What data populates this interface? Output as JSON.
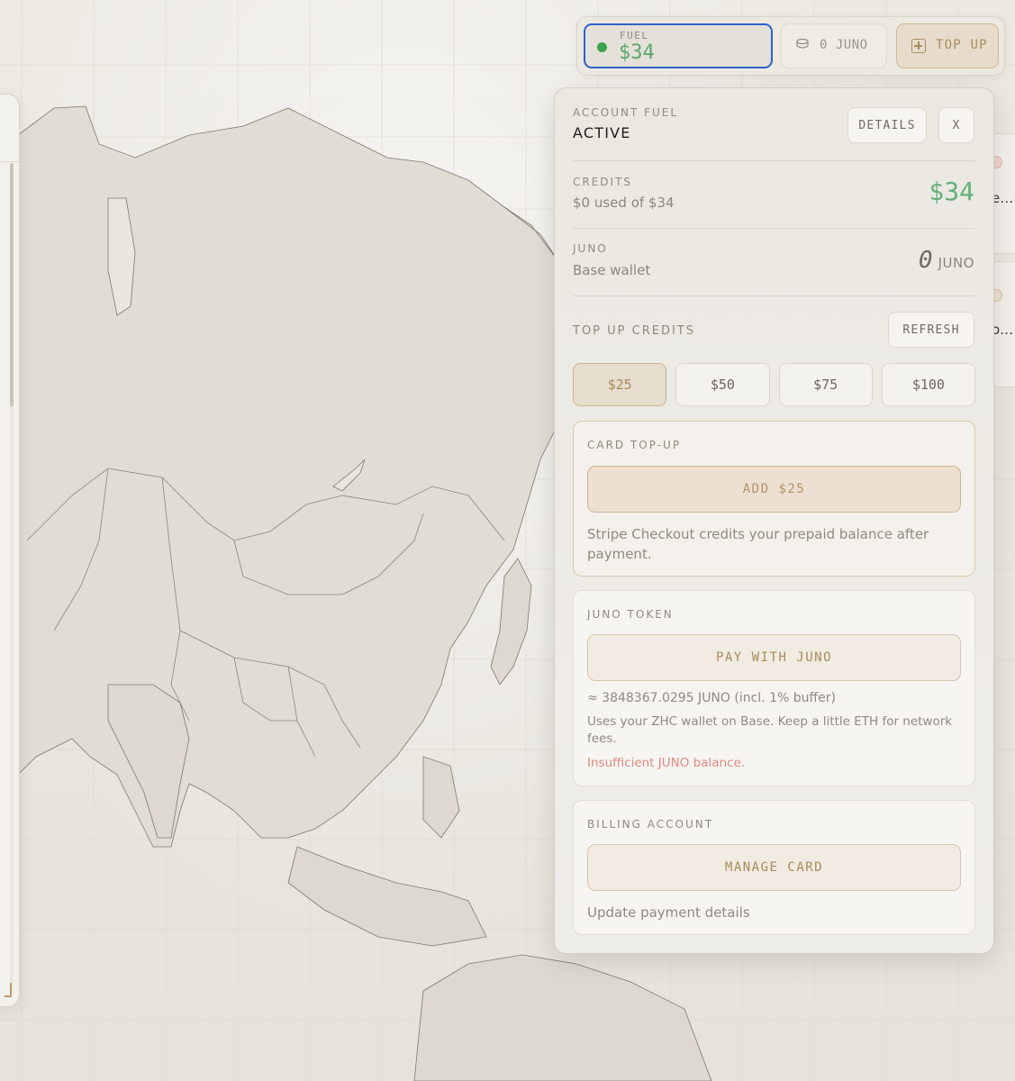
{
  "topbar": {
    "fuel_label": "FUEL",
    "fuel_value": "$34",
    "juno_balance": "0 JUNO",
    "topup_label": "TOP UP"
  },
  "panel": {
    "header_label": "ACCOUNT FUEL",
    "status": "ACTIVE",
    "details_button": "DETAILS",
    "close_button": "X",
    "credits": {
      "label": "CREDITS",
      "usage": "$0 used of $34",
      "value": "$34"
    },
    "juno": {
      "label": "JUNO",
      "sub": "Base wallet",
      "value": "0",
      "unit": "JUNO"
    },
    "topup": {
      "label": "TOP UP CREDITS",
      "refresh_button": "REFRESH",
      "amounts": [
        "$25",
        "$50",
        "$75",
        "$100"
      ],
      "selected": "$25"
    },
    "card_topup": {
      "label": "CARD TOP-UP",
      "button": "ADD $25",
      "note": "Stripe Checkout credits your prepaid balance after payment."
    },
    "juno_token": {
      "label": "JUNO TOKEN",
      "button": "PAY WITH JUNO",
      "estimate": "≈ 3848367.0295 JUNO (incl. 1% buffer)",
      "note": "Uses your ZHC wallet on Base. Keep a little ETH for network fees.",
      "error": "Insufficient JUNO balance."
    },
    "billing": {
      "label": "BILLING ACCOUNT",
      "button": "MANAGE CARD",
      "note": "Update payment details"
    }
  },
  "colors": {
    "accent_blue": "#2f62c9",
    "fuel_green": "#5aa66a",
    "status_dot": "#3da24d",
    "gold": "#a88b5c",
    "error": "#dc8a80"
  },
  "icons": {
    "status": "status-dot-icon",
    "juno": "coin-stack-icon",
    "topup": "plus-square-icon"
  }
}
